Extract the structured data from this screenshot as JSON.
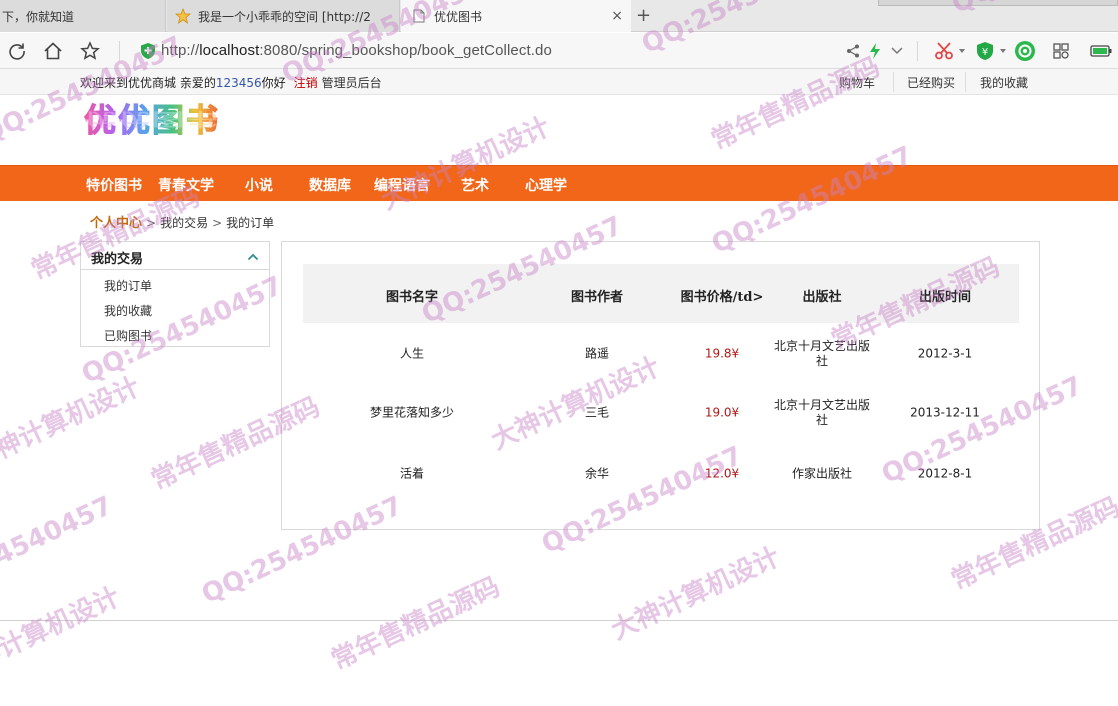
{
  "browser": {
    "tabs": [
      {
        "label": "下，你就知道",
        "active": false
      },
      {
        "label": "我是一个小乖乖的空间 [http://2",
        "active": false
      },
      {
        "label": "优优图书",
        "active": true
      }
    ],
    "tab_close": "×",
    "new_tab": "+",
    "url_prefix": "http://",
    "url_host": "localhost",
    "url_path": ":8080/spring_bookshop/book_getCollect.do"
  },
  "site": {
    "welcome_text": "欢迎来到优优商城   亲爱的",
    "username": "123456",
    "welcome_suffix": "你好",
    "logout": "注销",
    "admin": "管理员后台",
    "top_links": [
      "购物车",
      "已经购买",
      "我的收藏"
    ],
    "logo_text": "优优图书"
  },
  "nav": {
    "items": [
      "特价图书",
      "青春文学",
      "小说",
      "数据库",
      "编程语言",
      "艺术",
      "心理学"
    ]
  },
  "breadcrumb": {
    "home": "个人中心",
    "sep": ">",
    "level2": "我的交易",
    "level3": "我的订单"
  },
  "sidebar": {
    "title": "我的交易",
    "items": [
      "我的订单",
      "我的收藏",
      "已购图书"
    ]
  },
  "table": {
    "headers": [
      "图书名字",
      "图书作者",
      "图书价格/td>",
      "出版社",
      "出版时间"
    ],
    "rows": [
      {
        "name": "人生",
        "author": "路遥",
        "price": "19.8",
        "currency": "¥",
        "publisher_l1": "北京十月文艺出版",
        "publisher_l2": "社",
        "date": "2012-3-1"
      },
      {
        "name": "梦里花落知多少",
        "author": "三毛",
        "price": "19.0",
        "currency": "¥",
        "publisher_l1": "北京十月文艺出版",
        "publisher_l2": "社",
        "date": "2013-12-11"
      },
      {
        "name": "活着",
        "author": "余华",
        "price": "12.0",
        "currency": "¥",
        "publisher_l1": "作家出版社",
        "publisher_l2": "",
        "date": "2012-8-1"
      }
    ]
  },
  "watermark": {
    "qq": "QQ:254540457",
    "sell": "常年售精品源码",
    "design": "大神计算机设计"
  },
  "colors": {
    "nav_bg": "#f2661a",
    "price": "#b01818",
    "breadcrumb_home": "#c26a0a",
    "logout": "#c00000",
    "watermark": "rgba(200,130,200,0.45)"
  }
}
